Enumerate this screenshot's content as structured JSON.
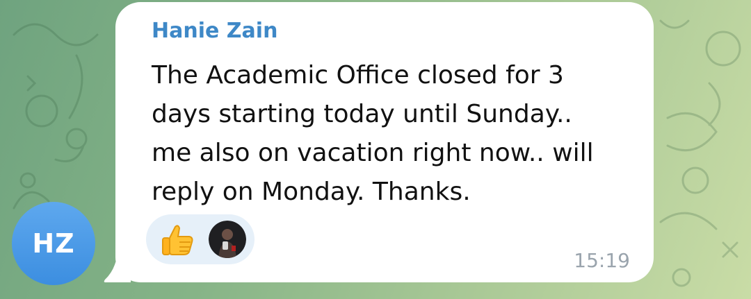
{
  "chat": {
    "sender_name": "Hanie Zain",
    "avatar_initials": "HZ",
    "message_text": "The Academic Office closed for 3\ndays starting today until Sunday..\nme also on vacation right now.. will\nreply on Monday. Thanks.",
    "timestamp": "15:19",
    "reaction": {
      "emoji_icon": "thumbs-up-icon",
      "reactor": "reactor-photo-avatar"
    }
  },
  "colors": {
    "sender_name": "#3e88c7",
    "avatar_bg": "#4a9be6",
    "bubble_bg": "#ffffff",
    "reaction_bg": "#e6f0f9",
    "timestamp": "#9aa4ad",
    "wallpaper": "#86b487"
  }
}
